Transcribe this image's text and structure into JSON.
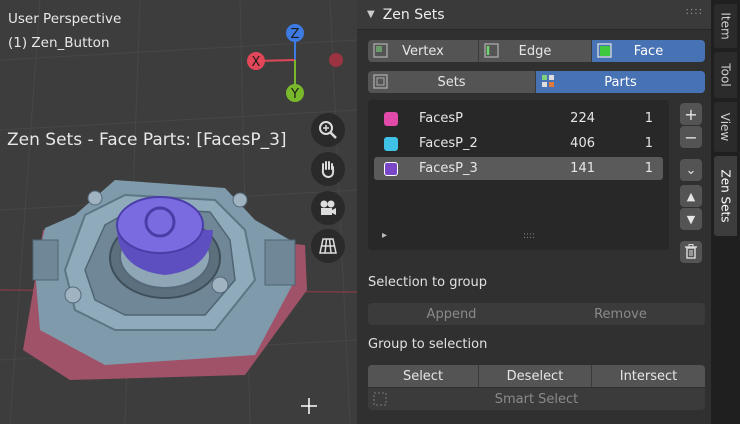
{
  "viewport": {
    "view_label": "User Perspective",
    "object_label": "(1) Zen_Button",
    "overlay_title": "Zen Sets - Face Parts: [FacesP_3]",
    "gizmo": {
      "z": "Z",
      "x": "X",
      "y": "Y"
    }
  },
  "panel": {
    "title": "Zen Sets",
    "mode_buttons": [
      "Vertex",
      "Edge",
      "Face"
    ],
    "mode_active": "Face",
    "type_buttons": [
      "Sets",
      "Parts"
    ],
    "type_active": "Parts",
    "list_rows": [
      {
        "name": "FacesP",
        "count": "224",
        "flag": "1",
        "color": "#e04aa8"
      },
      {
        "name": "FacesP_2",
        "count": "406",
        "flag": "1",
        "color": "#3fc2e6"
      },
      {
        "name": "FacesP_3",
        "count": "141",
        "flag": "1",
        "color": "#7a46c8"
      }
    ],
    "selected_row": "FacesP_3",
    "list_resize_handle": "::::",
    "list_expand_arrow": "▸",
    "side_buttons": {
      "add": "+",
      "remove": "−",
      "menu": "⌄",
      "up": "▲",
      "down": "▼"
    },
    "selection_to_group_label": "Selection to group",
    "append_label": "Append",
    "remove_label": "Remove",
    "group_to_selection_label": "Group to selection",
    "select_label": "Select",
    "deselect_label": "Deselect",
    "intersect_label": "Intersect",
    "smart_select_label": "Smart Select"
  },
  "side_tabs": [
    "Item",
    "Tool",
    "View",
    "Zen Sets"
  ],
  "active_tab": "Zen Sets",
  "colors": {
    "accent": "#4772b3",
    "viewport_bg": "#3d3d3d",
    "panel_bg": "#303030"
  }
}
